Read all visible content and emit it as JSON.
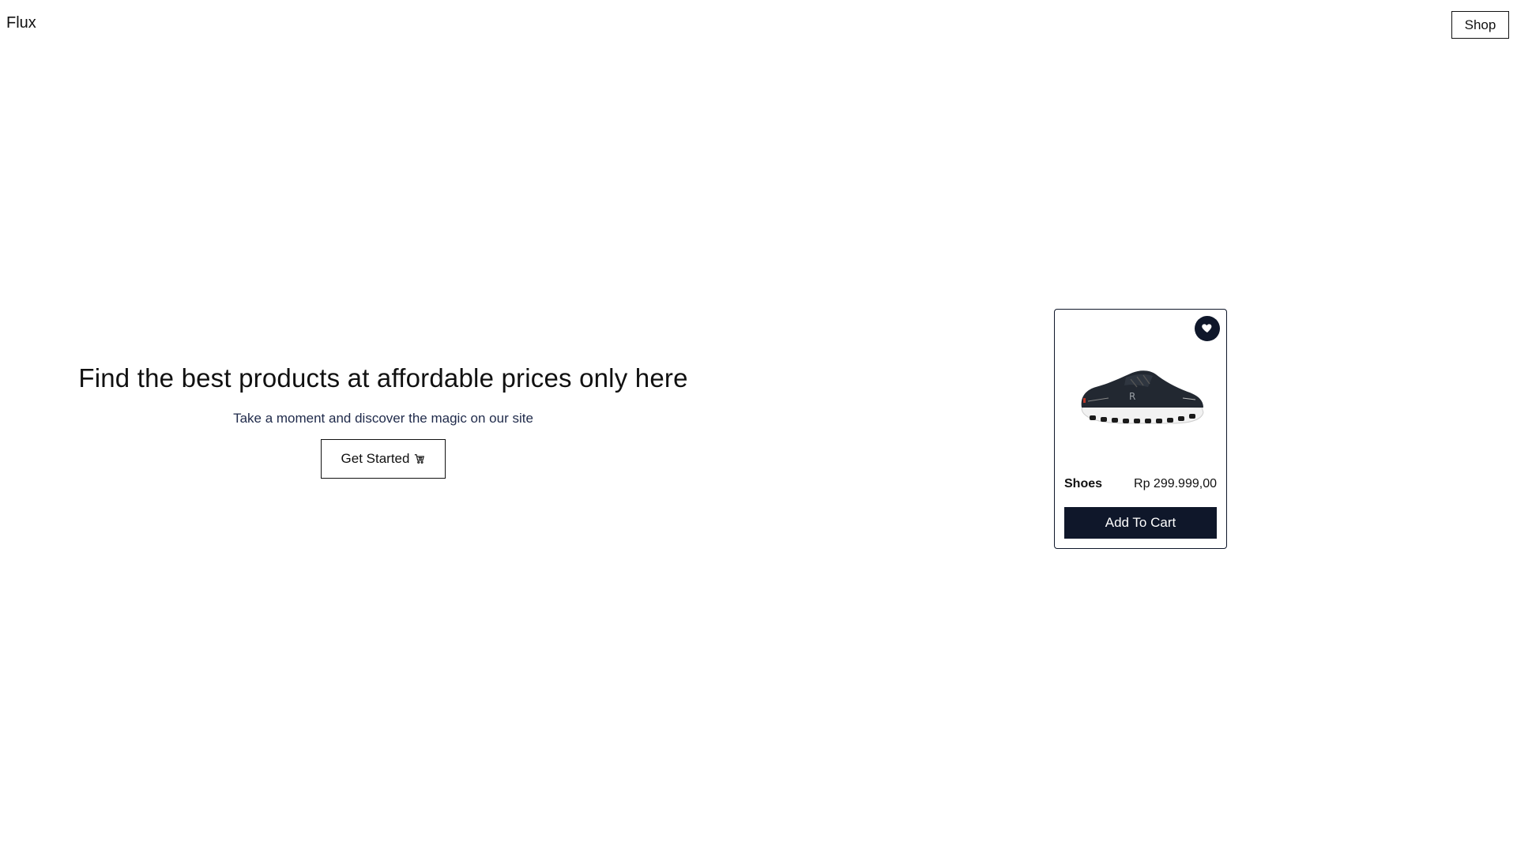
{
  "header": {
    "brand": "Flux",
    "shop_label": "Shop"
  },
  "hero": {
    "title": "Find the best products at affordable prices only here",
    "subtitle": "Take a moment and discover the magic on our site",
    "cta_label": "Get Started",
    "cta_icon": "cart-icon"
  },
  "product": {
    "name": "Shoes",
    "price": "Rp 299.999,00",
    "add_label": "Add To Cart",
    "favorite_icon": "heart-icon",
    "image_icon": "shoe-image",
    "accent_color": "#0f172a"
  }
}
